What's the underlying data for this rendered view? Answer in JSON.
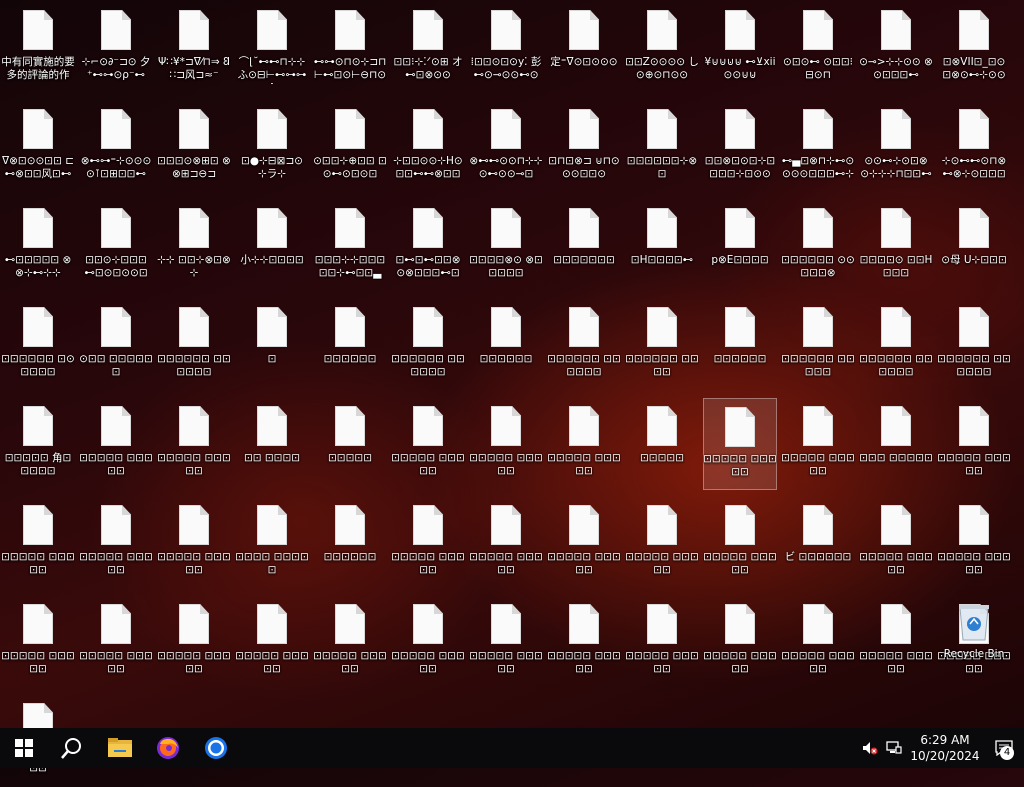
{
  "desktop": {
    "files": [
      {
        "label": "中有同實施的要 多的評論的作"
      },
      {
        "label": "⊹⌐⊙∂⁻⊐⊙ 夕⁺⊷⊶⊙ρ⁻⊷"
      },
      {
        "label": "Ψ∷¥*⊐ᐁ⁄⊓⇒ 𐐒∷⊐风⊐≈⁻"
      },
      {
        "label": "⌒⌊˘⊷⊷⊓⊹⊹ ふ⊙⊟⊢⊷⊶⊶A"
      },
      {
        "label": "⊷⊶⊙⊓⊙⊹⊐⊓ ⊢⊷⊡⊙⊢⊖⊓⊙"
      },
      {
        "label": "⊡⊡⁝⊹⁚ᐟ⊙⊞ オ⊷⊡⊗⊙⊙"
      },
      {
        "label": "⁞⊡⊡⊙⊡⊙y⁚ 彭⊷⊙⊸⊙⊙⊷⊙"
      },
      {
        "label": "定⁼ᐁ⊙⊡⊙⊙⊙"
      },
      {
        "label": "⊡⊡Z⊙⊙⊙⊙ し⊙⊕⊙⊓⊙⊙"
      },
      {
        "label": "¥⊍⊍⊍⊍ ⊷⊻xii⊙⊙⊍⊍"
      },
      {
        "label": "⊙⊡⊙⊷ ⊙⊡⊡⁝⊟⊙⊓"
      },
      {
        "label": "⊙⊸>⊹⊹⊙⊙ ⊗⊙⊡⊡⊡⊷"
      },
      {
        "label": "⊡⊗VII⊡_⊡⊙ ⊡⊗⊙⊷⊹⊙⊙"
      },
      {
        "label": "ᐁ⊗⊡⊙⊙⊡⊡ ⊏⊷⊗⊡⊡风⊡⊷"
      },
      {
        "label": "⊗⊷⊶⁼⊹⊙⊙⊙ ⊙⊺⊡⊞⊡⊡⊷"
      },
      {
        "label": "⊡⊡⊡⊙⊗⊞⊡ ⊗⊗⊞⊐⊖⊐"
      },
      {
        "label": "⊡●⊹⊟⊠⊐⊙ ⊹ラ⊹"
      },
      {
        "label": "⊙⊡⊡⊹⊕⊡⊡ ⊡⊙⊷⊙⊡⊙⊡"
      },
      {
        "label": "⊹⊡⊡⊙⊙⊹H⊙ ⊡⊡⊷⊷⊗⊡⊡"
      },
      {
        "label": "⊗⊷⊷⊙⊙⊓⊹⊹ ⊙⊷⊙⊙⊸⊡"
      },
      {
        "label": "⊡⊓⊡⊗⊐ ⊍⊓⊙⊙⊙⊡⊡⊙"
      },
      {
        "label": "⊡⊡⊡⊡⊡⊡⊹⊗⊡"
      },
      {
        "label": "⊡⊡⊗⊡⊙⊡⊹⊡ ⊡⊡⊡⊹⊡⊙⊙"
      },
      {
        "label": "⊷▄⊡⊗⊓⊹⊷⊙ ⊙⊙⊙⊡⊡⊡⊷⊹"
      },
      {
        "label": "⊙⊙⊷⊹⊙⊡⊗ ⊙⊹⊹⊹⊓⊡⊡⊷"
      },
      {
        "label": "⊹⊙⊷⊷⊙⊓⊗ ⊷⊗⊹⊙⊡⊡⊡"
      },
      {
        "label": "⊷⊡⊡⊡⊡⊡ ⊗⊗⊹⊷⊹⊹"
      },
      {
        "label": "⊡⊡⊙⊹⊡⊡⊡ ⊷⊡⊙⊡⊙⊙⊡"
      },
      {
        "label": "⊹⊹ ⊡⊡⊹⊗⊡⊗⊹"
      },
      {
        "label": "小⊹⊹⊡⊡⊡⊡"
      },
      {
        "label": "⊡⊡⊡⊹⊹⊡⊡⊡ ⊡⊡⊹⊷⊡⊡▃"
      },
      {
        "label": "⊡⊷⊡⊷⊡⊡⊗ ⊙⊗⊡⊡⊡⊷⊡"
      },
      {
        "label": "⊡⊡⊡⊡⊗⊙ ⊗⊡⊡⊡⊡⊡"
      },
      {
        "label": "⊡⊡⊡⊡⊡⊡⊡"
      },
      {
        "label": "⊡H⊡⊡⊡⊡⊷"
      },
      {
        "label": "p⊗E⊡⊡⊡⊡"
      },
      {
        "label": "⊡⊡⊡⊡⊡⊡ ⊙⊙⊡⊡⊡⊗"
      },
      {
        "label": "⊡⊡⊡⊡⊙ ⊡⊡H⊡⊡⊡"
      },
      {
        "label": "⊙母 U⊹⊡⊡⊡"
      },
      {
        "label": "⊡⊡⊡⊡⊡⊡ ⊡⊙⊡⊡⊡⊡"
      },
      {
        "label": "⊙⊡⊡ ⊡⊡⊡⊡⊡⊡"
      },
      {
        "label": "⊡⊡⊡⊡⊡⊡ ⊡⊡⊡⊡⊡⊡"
      },
      {
        "label": "⊡"
      },
      {
        "label": "⊡⊡⊡⊡⊡⊡"
      },
      {
        "label": "⊡⊡⊡⊡⊡⊡ ⊡⊡⊡⊡⊡⊡"
      },
      {
        "label": "⊡⊡⊡⊡⊡⊡"
      },
      {
        "label": "⊡⊡⊡⊡⊡⊡ ⊡⊡⊡⊡⊡⊡"
      },
      {
        "label": "⊡⊡⊡⊡⊡⊡ ⊡⊡⊡⊡"
      },
      {
        "label": "⊡⊡⊡⊡⊡⊡"
      },
      {
        "label": "⊡⊡⊡⊡⊡⊡ ⊡⊡⊡⊡⊡"
      },
      {
        "label": "⊡⊡⊡⊡⊡⊡ ⊡⊡⊡⊡⊡⊡"
      },
      {
        "label": "⊡⊡⊡⊡⊡⊡ ⊡⊡⊡⊡⊡⊡"
      },
      {
        "label": "⊡⊡⊡⊡⊡ 角⊡⊡⊡⊡⊡"
      },
      {
        "label": "⊡⊡⊡⊡⊡ ⊡⊡⊡⊡⊡"
      },
      {
        "label": "⊡⊡⊡⊡⊡ ⊡⊡⊡⊡⊡"
      },
      {
        "label": "⊡⊡ ⊡⊡⊡⊡"
      },
      {
        "label": "⊡⊡⊡⊡⊡"
      },
      {
        "label": "⊡⊡⊡⊡⊡ ⊡⊡⊡⊡⊡"
      },
      {
        "label": "⊡⊡⊡⊡⊡ ⊡⊡⊡⊡⊡"
      },
      {
        "label": "⊡⊡⊡⊡⊡ ⊡⊡⊡⊡⊡"
      },
      {
        "label": "⊡⊡⊡⊡⊡"
      },
      {
        "label": "⊡⊡⊡⊡⊡ ⊡⊡⊡⊡⊡",
        "selected": true
      },
      {
        "label": "⊡⊡⊡⊡⊡ ⊡⊡⊡⊡⊡"
      },
      {
        "label": "⊡⊡⊡ ⊡⊡⊡⊡⊡"
      },
      {
        "label": "⊡⊡⊡⊡⊡ ⊡⊡⊡⊡⊡"
      },
      {
        "label": "⊡⊡⊡⊡⊡ ⊡⊡⊡⊡⊡"
      },
      {
        "label": "⊡⊡⊡⊡⊡ ⊡⊡⊡⊡⊡"
      },
      {
        "label": "⊡⊡⊡⊡⊡ ⊡⊡⊡⊡⊡"
      },
      {
        "label": "⊡⊡⊡⊡ ⊡⊡⊡⊡⊡"
      },
      {
        "label": "⊡⊡⊡⊡⊡⊡"
      },
      {
        "label": "⊡⊡⊡⊡⊡ ⊡⊡⊡⊡⊡"
      },
      {
        "label": "⊡⊡⊡⊡⊡ ⊡⊡⊡⊡⊡"
      },
      {
        "label": "⊡⊡⊡⊡⊡ ⊡⊡⊡⊡⊡"
      },
      {
        "label": "⊡⊡⊡⊡⊡ ⊡⊡⊡⊡⊡"
      },
      {
        "label": "⊡⊡⊡⊡⊡ ⊡⊡⊡⊡⊡"
      },
      {
        "label": "ビ ⊡⊡⊡⊡⊡⊡"
      },
      {
        "label": "⊡⊡⊡⊡⊡ ⊡⊡⊡⊡⊡"
      },
      {
        "label": "⊡⊡⊡⊡⊡ ⊡⊡⊡⊡⊡"
      },
      {
        "label": "⊡⊡⊡⊡⊡ ⊡⊡⊡⊡⊡"
      },
      {
        "label": "⊡⊡⊡⊡⊡ ⊡⊡⊡⊡⊡"
      },
      {
        "label": "⊡⊡⊡⊡⊡ ⊡⊡⊡⊡⊡"
      },
      {
        "label": "⊡⊡⊡⊡⊡ ⊡⊡⊡⊡⊡"
      },
      {
        "label": "⊡⊡⊡⊡⊡ ⊡⊡⊡⊡⊡"
      },
      {
        "label": "⊡⊡⊡⊡⊡ ⊡⊡⊡⊡⊡"
      },
      {
        "label": "⊡⊡⊡⊡⊡ ⊡⊡⊡⊡⊡"
      },
      {
        "label": "⊡⊡⊡⊡⊡ ⊡⊡⊡⊡⊡"
      },
      {
        "label": "⊡⊡⊡⊡⊡ ⊡⊡⊡⊡⊡"
      },
      {
        "label": "⊡⊡⊡⊡⊡ ⊡⊡⊡⊡⊡"
      },
      {
        "label": "⊡⊡⊡⊡⊡ ⊡⊡⊡⊡⊡"
      },
      {
        "label": "⊡⊡⊡⊡⊡ ⊡⊡⊡⊡⊡"
      },
      {
        "label": "⊡⊡⊡⊡⊡ ⊡⊡⊡⊡⊡"
      },
      {
        "label": "⊡⊡⊡⊡⊡ ⊡⊡⊡⊡⊡"
      }
    ],
    "recycle_bin_label": "Recycle Bin"
  },
  "taskbar": {
    "start": "start-icon",
    "search": "search-icon",
    "pinned": [
      "file-explorer-icon",
      "firefox-icon",
      "chrome-icon"
    ],
    "tray": {
      "volume_icon": "volume-muted-icon",
      "network_icon": "network-icon",
      "time": "6:29 AM",
      "date": "10/20/2024",
      "notifications_count": "4"
    }
  },
  "colors": {
    "taskbar_bg": "#0a0a0c",
    "accent_blue": "#1a6fd6"
  }
}
